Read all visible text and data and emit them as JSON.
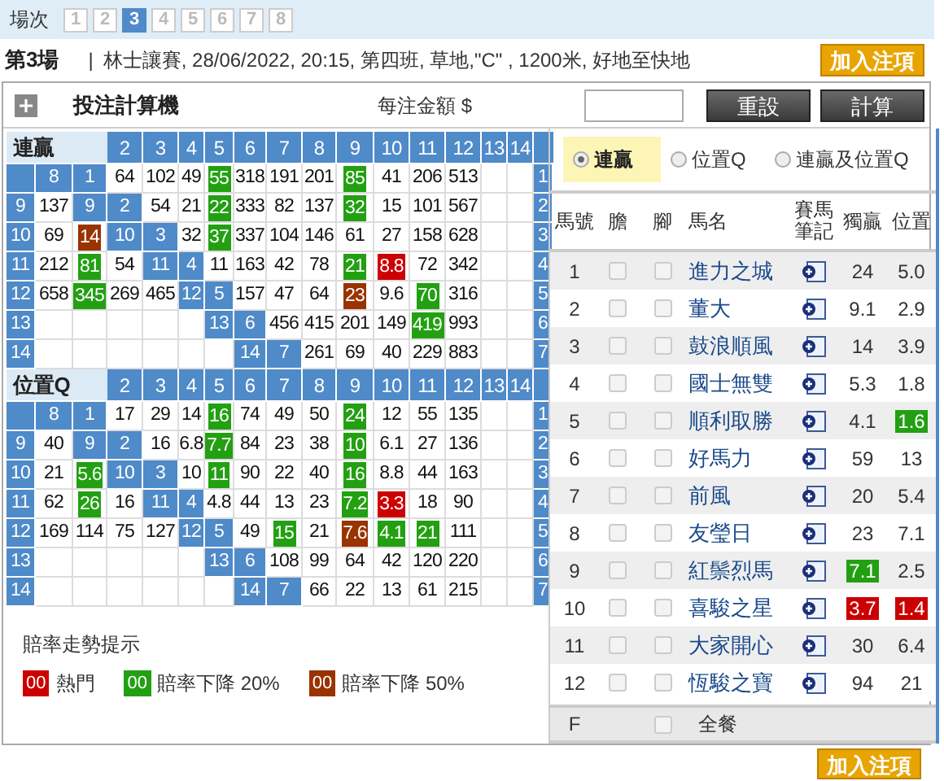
{
  "race_selector": {
    "label": "場次",
    "tabs": [
      {
        "text": "1",
        "selected": false
      },
      {
        "text": "2",
        "selected": false
      },
      {
        "text": "3",
        "selected": true
      },
      {
        "text": "4",
        "selected": false
      },
      {
        "text": "5",
        "selected": false
      },
      {
        "text": "6",
        "selected": false
      },
      {
        "text": "7",
        "selected": false
      },
      {
        "text": "8",
        "selected": false
      }
    ]
  },
  "race_info": {
    "title": "第3場",
    "separator": "|",
    "details": "林士讓賽, 28/06/2022, 20:15, 第四班, 草地,\"C\" , 1200米, 好地至快地"
  },
  "add_button_top": "加入注項",
  "calculator": {
    "title": "投注計算機",
    "amount_label": "每注金額 $",
    "reset": "重設",
    "calculate": "計算"
  },
  "grids": [
    {
      "title": "連贏",
      "header_numbers": [
        "2",
        "3",
        "4",
        "5",
        "6",
        "7",
        "8",
        "9",
        "10",
        "11",
        "12",
        "13",
        "14"
      ],
      "rows": [
        [
          {
            "kind": "label",
            "text": ""
          },
          {
            "kind": "label",
            "text": "8"
          },
          {
            "kind": "label",
            "text": "1"
          },
          {
            "kind": "odds",
            "text": "64"
          },
          {
            "kind": "odds",
            "text": "102"
          },
          {
            "kind": "odds",
            "text": "49"
          },
          {
            "kind": "odds",
            "text": "55",
            "color": "#22a012"
          },
          {
            "kind": "odds",
            "text": "318"
          },
          {
            "kind": "odds",
            "text": "191"
          },
          {
            "kind": "odds",
            "text": "201"
          },
          {
            "kind": "odds",
            "text": "85",
            "color": "#22a012"
          },
          {
            "kind": "odds",
            "text": "41"
          },
          {
            "kind": "odds",
            "text": "206"
          },
          {
            "kind": "odds",
            "text": "513"
          },
          {
            "kind": "empty"
          },
          {
            "kind": "empty"
          },
          {
            "kind": "label",
            "text": "1"
          }
        ],
        [
          {
            "kind": "label",
            "text": "9"
          },
          {
            "kind": "odds",
            "text": "137"
          },
          {
            "kind": "label",
            "text": "9"
          },
          {
            "kind": "label",
            "text": "2"
          },
          {
            "kind": "odds",
            "text": "54"
          },
          {
            "kind": "odds",
            "text": "21"
          },
          {
            "kind": "odds",
            "text": "22",
            "color": "#22a012"
          },
          {
            "kind": "odds",
            "text": "333"
          },
          {
            "kind": "odds",
            "text": "82"
          },
          {
            "kind": "odds",
            "text": "137"
          },
          {
            "kind": "odds",
            "text": "32",
            "color": "#22a012"
          },
          {
            "kind": "odds",
            "text": "15"
          },
          {
            "kind": "odds",
            "text": "101"
          },
          {
            "kind": "odds",
            "text": "567"
          },
          {
            "kind": "empty"
          },
          {
            "kind": "empty"
          },
          {
            "kind": "label",
            "text": "2"
          }
        ],
        [
          {
            "kind": "label",
            "text": "10"
          },
          {
            "kind": "odds",
            "text": "69"
          },
          {
            "kind": "odds",
            "text": "14",
            "color": "#993300"
          },
          {
            "kind": "label",
            "text": "10"
          },
          {
            "kind": "label",
            "text": "3"
          },
          {
            "kind": "odds",
            "text": "32"
          },
          {
            "kind": "odds",
            "text": "37",
            "color": "#22a012"
          },
          {
            "kind": "odds",
            "text": "337"
          },
          {
            "kind": "odds",
            "text": "104"
          },
          {
            "kind": "odds",
            "text": "146"
          },
          {
            "kind": "odds",
            "text": "61"
          },
          {
            "kind": "odds",
            "text": "27"
          },
          {
            "kind": "odds",
            "text": "158"
          },
          {
            "kind": "odds",
            "text": "628"
          },
          {
            "kind": "empty"
          },
          {
            "kind": "empty"
          },
          {
            "kind": "label",
            "text": "3"
          }
        ],
        [
          {
            "kind": "label",
            "text": "11"
          },
          {
            "kind": "odds",
            "text": "212"
          },
          {
            "kind": "odds",
            "text": "81",
            "color": "#22a012"
          },
          {
            "kind": "odds",
            "text": "54"
          },
          {
            "kind": "label",
            "text": "11"
          },
          {
            "kind": "label",
            "text": "4"
          },
          {
            "kind": "odds",
            "text": "11"
          },
          {
            "kind": "odds",
            "text": "163"
          },
          {
            "kind": "odds",
            "text": "42"
          },
          {
            "kind": "odds",
            "text": "78"
          },
          {
            "kind": "odds",
            "text": "21",
            "color": "#22a012"
          },
          {
            "kind": "odds",
            "text": "8.8",
            "color": "#cc0000"
          },
          {
            "kind": "odds",
            "text": "72"
          },
          {
            "kind": "odds",
            "text": "342"
          },
          {
            "kind": "empty"
          },
          {
            "kind": "empty"
          },
          {
            "kind": "label",
            "text": "4"
          }
        ],
        [
          {
            "kind": "label",
            "text": "12"
          },
          {
            "kind": "odds",
            "text": "658"
          },
          {
            "kind": "odds",
            "text": "345",
            "color": "#22a012"
          },
          {
            "kind": "odds",
            "text": "269"
          },
          {
            "kind": "odds",
            "text": "465"
          },
          {
            "kind": "label",
            "text": "12"
          },
          {
            "kind": "label",
            "text": "5"
          },
          {
            "kind": "odds",
            "text": "157"
          },
          {
            "kind": "odds",
            "text": "47"
          },
          {
            "kind": "odds",
            "text": "64"
          },
          {
            "kind": "odds",
            "text": "23",
            "color": "#993300"
          },
          {
            "kind": "odds",
            "text": "9.6"
          },
          {
            "kind": "odds",
            "text": "70",
            "color": "#22a012"
          },
          {
            "kind": "odds",
            "text": "316"
          },
          {
            "kind": "empty"
          },
          {
            "kind": "empty"
          },
          {
            "kind": "label",
            "text": "5"
          }
        ],
        [
          {
            "kind": "label",
            "text": "13"
          },
          {
            "kind": "empty"
          },
          {
            "kind": "empty"
          },
          {
            "kind": "empty"
          },
          {
            "kind": "empty"
          },
          {
            "kind": "empty"
          },
          {
            "kind": "label",
            "text": "13"
          },
          {
            "kind": "label",
            "text": "6"
          },
          {
            "kind": "odds",
            "text": "456"
          },
          {
            "kind": "odds",
            "text": "415"
          },
          {
            "kind": "odds",
            "text": "201"
          },
          {
            "kind": "odds",
            "text": "149"
          },
          {
            "kind": "odds",
            "text": "419",
            "color": "#22a012"
          },
          {
            "kind": "odds",
            "text": "993"
          },
          {
            "kind": "empty"
          },
          {
            "kind": "empty"
          },
          {
            "kind": "label",
            "text": "6"
          }
        ],
        [
          {
            "kind": "label",
            "text": "14"
          },
          {
            "kind": "empty"
          },
          {
            "kind": "empty"
          },
          {
            "kind": "empty"
          },
          {
            "kind": "empty"
          },
          {
            "kind": "empty"
          },
          {
            "kind": "empty"
          },
          {
            "kind": "label",
            "text": "14"
          },
          {
            "kind": "label",
            "text": "7"
          },
          {
            "kind": "odds",
            "text": "261"
          },
          {
            "kind": "odds",
            "text": "69"
          },
          {
            "kind": "odds",
            "text": "40"
          },
          {
            "kind": "odds",
            "text": "229"
          },
          {
            "kind": "odds",
            "text": "883"
          },
          {
            "kind": "empty"
          },
          {
            "kind": "empty"
          },
          {
            "kind": "label",
            "text": "7"
          }
        ]
      ]
    },
    {
      "title": "位置Q",
      "header_numbers": [
        "2",
        "3",
        "4",
        "5",
        "6",
        "7",
        "8",
        "9",
        "10",
        "11",
        "12",
        "13",
        "14"
      ],
      "rows": [
        [
          {
            "kind": "label",
            "text": ""
          },
          {
            "kind": "label",
            "text": "8"
          },
          {
            "kind": "label",
            "text": "1"
          },
          {
            "kind": "odds",
            "text": "17"
          },
          {
            "kind": "odds",
            "text": "29"
          },
          {
            "kind": "odds",
            "text": "14"
          },
          {
            "kind": "odds",
            "text": "16",
            "color": "#22a012"
          },
          {
            "kind": "odds",
            "text": "74"
          },
          {
            "kind": "odds",
            "text": "49"
          },
          {
            "kind": "odds",
            "text": "50"
          },
          {
            "kind": "odds",
            "text": "24",
            "color": "#22a012"
          },
          {
            "kind": "odds",
            "text": "12"
          },
          {
            "kind": "odds",
            "text": "55"
          },
          {
            "kind": "odds",
            "text": "135"
          },
          {
            "kind": "empty"
          },
          {
            "kind": "empty"
          },
          {
            "kind": "label",
            "text": "1"
          }
        ],
        [
          {
            "kind": "label",
            "text": "9"
          },
          {
            "kind": "odds",
            "text": "40"
          },
          {
            "kind": "label",
            "text": "9"
          },
          {
            "kind": "label",
            "text": "2"
          },
          {
            "kind": "odds",
            "text": "16"
          },
          {
            "kind": "odds",
            "text": "6.8"
          },
          {
            "kind": "odds",
            "text": "7.7",
            "color": "#22a012"
          },
          {
            "kind": "odds",
            "text": "84"
          },
          {
            "kind": "odds",
            "text": "23"
          },
          {
            "kind": "odds",
            "text": "38"
          },
          {
            "kind": "odds",
            "text": "10",
            "color": "#22a012"
          },
          {
            "kind": "odds",
            "text": "6.1"
          },
          {
            "kind": "odds",
            "text": "27"
          },
          {
            "kind": "odds",
            "text": "136"
          },
          {
            "kind": "empty"
          },
          {
            "kind": "empty"
          },
          {
            "kind": "label",
            "text": "2"
          }
        ],
        [
          {
            "kind": "label",
            "text": "10"
          },
          {
            "kind": "odds",
            "text": "21"
          },
          {
            "kind": "odds",
            "text": "5.6",
            "color": "#22a012"
          },
          {
            "kind": "label",
            "text": "10"
          },
          {
            "kind": "label",
            "text": "3"
          },
          {
            "kind": "odds",
            "text": "10"
          },
          {
            "kind": "odds",
            "text": "11",
            "color": "#22a012"
          },
          {
            "kind": "odds",
            "text": "90"
          },
          {
            "kind": "odds",
            "text": "22"
          },
          {
            "kind": "odds",
            "text": "40"
          },
          {
            "kind": "odds",
            "text": "16",
            "color": "#22a012"
          },
          {
            "kind": "odds",
            "text": "8.8"
          },
          {
            "kind": "odds",
            "text": "44"
          },
          {
            "kind": "odds",
            "text": "163"
          },
          {
            "kind": "empty"
          },
          {
            "kind": "empty"
          },
          {
            "kind": "label",
            "text": "3"
          }
        ],
        [
          {
            "kind": "label",
            "text": "11"
          },
          {
            "kind": "odds",
            "text": "62"
          },
          {
            "kind": "odds",
            "text": "26",
            "color": "#22a012"
          },
          {
            "kind": "odds",
            "text": "16"
          },
          {
            "kind": "label",
            "text": "11"
          },
          {
            "kind": "label",
            "text": "4"
          },
          {
            "kind": "odds",
            "text": "4.8"
          },
          {
            "kind": "odds",
            "text": "44"
          },
          {
            "kind": "odds",
            "text": "13"
          },
          {
            "kind": "odds",
            "text": "23"
          },
          {
            "kind": "odds",
            "text": "7.2",
            "color": "#22a012"
          },
          {
            "kind": "odds",
            "text": "3.3",
            "color": "#cc0000"
          },
          {
            "kind": "odds",
            "text": "18"
          },
          {
            "kind": "odds",
            "text": "90"
          },
          {
            "kind": "empty"
          },
          {
            "kind": "empty"
          },
          {
            "kind": "label",
            "text": "4"
          }
        ],
        [
          {
            "kind": "label",
            "text": "12"
          },
          {
            "kind": "odds",
            "text": "169"
          },
          {
            "kind": "odds",
            "text": "114"
          },
          {
            "kind": "odds",
            "text": "75"
          },
          {
            "kind": "odds",
            "text": "127"
          },
          {
            "kind": "label",
            "text": "12"
          },
          {
            "kind": "label",
            "text": "5"
          },
          {
            "kind": "odds",
            "text": "49"
          },
          {
            "kind": "odds",
            "text": "15",
            "color": "#22a012"
          },
          {
            "kind": "odds",
            "text": "21"
          },
          {
            "kind": "odds",
            "text": "7.6",
            "color": "#993300"
          },
          {
            "kind": "odds",
            "text": "4.1",
            "color": "#22a012"
          },
          {
            "kind": "odds",
            "text": "21",
            "color": "#22a012"
          },
          {
            "kind": "odds",
            "text": "111"
          },
          {
            "kind": "empty"
          },
          {
            "kind": "empty"
          },
          {
            "kind": "label",
            "text": "5"
          }
        ],
        [
          {
            "kind": "label",
            "text": "13"
          },
          {
            "kind": "empty"
          },
          {
            "kind": "empty"
          },
          {
            "kind": "empty"
          },
          {
            "kind": "empty"
          },
          {
            "kind": "empty"
          },
          {
            "kind": "label",
            "text": "13"
          },
          {
            "kind": "label",
            "text": "6"
          },
          {
            "kind": "odds",
            "text": "108"
          },
          {
            "kind": "odds",
            "text": "99"
          },
          {
            "kind": "odds",
            "text": "64"
          },
          {
            "kind": "odds",
            "text": "42"
          },
          {
            "kind": "odds",
            "text": "120"
          },
          {
            "kind": "odds",
            "text": "220"
          },
          {
            "kind": "empty"
          },
          {
            "kind": "empty"
          },
          {
            "kind": "label",
            "text": "6"
          }
        ],
        [
          {
            "kind": "label",
            "text": "14"
          },
          {
            "kind": "empty"
          },
          {
            "kind": "empty"
          },
          {
            "kind": "empty"
          },
          {
            "kind": "empty"
          },
          {
            "kind": "empty"
          },
          {
            "kind": "empty"
          },
          {
            "kind": "label",
            "text": "14"
          },
          {
            "kind": "label",
            "text": "7"
          },
          {
            "kind": "odds",
            "text": "66"
          },
          {
            "kind": "odds",
            "text": "22"
          },
          {
            "kind": "odds",
            "text": "13"
          },
          {
            "kind": "odds",
            "text": "61"
          },
          {
            "kind": "odds",
            "text": "215"
          },
          {
            "kind": "empty"
          },
          {
            "kind": "empty"
          },
          {
            "kind": "label",
            "text": "7"
          }
        ]
      ]
    }
  ],
  "legend": {
    "title": "賠率走勢提示",
    "items": [
      {
        "swatch": "00",
        "label": "熱門",
        "color": "#cc0000"
      },
      {
        "swatch": "00",
        "label": "賠率下降 20%",
        "color": "#22a012"
      },
      {
        "swatch": "00",
        "label": "賠率下降 50%",
        "color": "#993300"
      }
    ]
  },
  "bet_types": [
    {
      "label": "連贏",
      "selected": true
    },
    {
      "label": "位置Q",
      "selected": false
    },
    {
      "label": "連贏及位置Q",
      "selected": false
    }
  ],
  "horse_table": {
    "columns": [
      "馬號",
      "膽",
      "腳",
      "馬名",
      "賽馬筆記",
      "獨贏",
      "位置"
    ],
    "rows": [
      {
        "number": "1",
        "banker": false,
        "leg": false,
        "name": "進力之城",
        "win": {
          "text": "24"
        },
        "place": {
          "text": "5.0"
        }
      },
      {
        "number": "2",
        "banker": false,
        "leg": false,
        "name": "董大",
        "win": {
          "text": "9.1"
        },
        "place": {
          "text": "2.9"
        }
      },
      {
        "number": "3",
        "banker": false,
        "leg": false,
        "name": "鼓浪順風",
        "win": {
          "text": "14"
        },
        "place": {
          "text": "3.9"
        }
      },
      {
        "number": "4",
        "banker": false,
        "leg": false,
        "name": "國士無雙",
        "win": {
          "text": "5.3"
        },
        "place": {
          "text": "1.8"
        }
      },
      {
        "number": "5",
        "banker": false,
        "leg": false,
        "name": "順利取勝",
        "win": {
          "text": "4.1"
        },
        "place": {
          "text": "1.6",
          "color": "#22a012"
        }
      },
      {
        "number": "6",
        "banker": false,
        "leg": false,
        "name": "好馬力",
        "win": {
          "text": "59"
        },
        "place": {
          "text": "13"
        }
      },
      {
        "number": "7",
        "banker": false,
        "leg": false,
        "name": "前風",
        "win": {
          "text": "20"
        },
        "place": {
          "text": "5.4"
        }
      },
      {
        "number": "8",
        "banker": false,
        "leg": false,
        "name": "友瑩日",
        "win": {
          "text": "23"
        },
        "place": {
          "text": "7.1"
        }
      },
      {
        "number": "9",
        "banker": false,
        "leg": false,
        "name": "紅鬃烈馬",
        "win": {
          "text": "7.1",
          "color": "#22a012"
        },
        "place": {
          "text": "2.5"
        }
      },
      {
        "number": "10",
        "banker": false,
        "leg": false,
        "name": "喜駿之星",
        "win": {
          "text": "3.7",
          "color": "#cc0000"
        },
        "place": {
          "text": "1.4",
          "color": "#cc0000"
        }
      },
      {
        "number": "11",
        "banker": false,
        "leg": false,
        "name": "大家開心",
        "win": {
          "text": "30"
        },
        "place": {
          "text": "6.4"
        }
      },
      {
        "number": "12",
        "banker": false,
        "leg": false,
        "name": "恆駿之寶",
        "win": {
          "text": "94"
        },
        "place": {
          "text": "21"
        }
      }
    ],
    "field_row": {
      "number": "F",
      "leg": false,
      "label": "全餐"
    }
  },
  "add_button_bottom": "加入注項"
}
